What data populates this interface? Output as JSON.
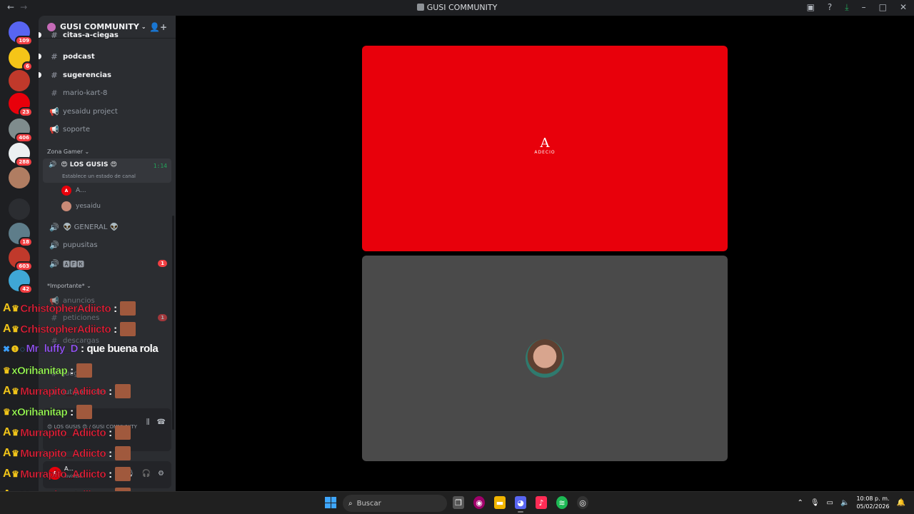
{
  "window": {
    "title": "GUSI COMMUNITY",
    "back": "←",
    "forward": "→"
  },
  "server_rail": [
    {
      "badge": "109",
      "color": "#5865f2"
    },
    {
      "badge": "6",
      "color": "#f5c518"
    },
    {
      "badge": "",
      "color": "#c0392b"
    },
    {
      "badge": "23",
      "color": "#e8000b"
    },
    {
      "badge": "406",
      "color": "#7f8c8d"
    },
    {
      "badge": "288",
      "color": "#ecf0f1"
    },
    {
      "badge": "",
      "color": "#b07d62"
    },
    {
      "badge": "",
      "color": "#2b2d31"
    },
    {
      "badge": "18",
      "color": "#5e7d8a"
    },
    {
      "badge": "603",
      "color": "#c0392b"
    },
    {
      "badge": "42",
      "color": "#3fa7d6"
    }
  ],
  "sidebar": {
    "server_name": "GUSI COMMUNITY",
    "channels_top": [
      {
        "name": "citas-a-ciegas",
        "icon": "hash-icon",
        "unread": true
      },
      {
        "name": "podcast",
        "icon": "hash-icon",
        "unread": true
      },
      {
        "name": "sugerencias",
        "icon": "hash-icon",
        "unread": true
      },
      {
        "name": "mario-kart-8",
        "icon": "hash-icon",
        "unread": false
      },
      {
        "name": "yesaidu project",
        "icon": "megaphone-icon",
        "unread": false
      },
      {
        "name": "soporte",
        "icon": "megaphone-icon",
        "unread": false
      }
    ],
    "category_zona": "Zona Gamer",
    "active_voice": {
      "name": "😍 LOS GUSIS 😍",
      "time": "1:14",
      "status": "Establece un estado de canal"
    },
    "voice_users": [
      {
        "name": "A...",
        "avatar": "A"
      },
      {
        "name": "yesaidu",
        "avatar": ""
      }
    ],
    "voice_channels": [
      {
        "name": "👽 GENERAL 👽",
        "mention": ""
      },
      {
        "name": "pupusitas",
        "mention": ""
      },
      {
        "name": "🅰🅵🅺",
        "mention": "1"
      }
    ],
    "category_importante": "*Importante*",
    "channels_bottom": [
      {
        "name": "anuncios",
        "icon": "megaphone-icon"
      },
      {
        "name": "peticiones",
        "icon": "hash-icon",
        "mention": "1"
      },
      {
        "name": "descargas",
        "icon": "hash-icon"
      },
      {
        "name": "juegitos",
        "icon": "hash-icon"
      },
      {
        "name": "lut-para-obs",
        "icon": "hash-icon"
      }
    ],
    "voice_panel_label": "😍 LOS GUSIS 😍 / GUSI COMMUNITY",
    "user_panel": {
      "name": "A...",
      "status": "Invisible",
      "avatar": "A"
    }
  },
  "stage": {
    "logo_letter": "A",
    "logo_text": "ADECIO"
  },
  "chat": [
    {
      "user": "CrhistopherAdiicto",
      "color": "#e0233b",
      "text": "",
      "emote": true,
      "badges": [
        "A",
        "crown"
      ]
    },
    {
      "user": "CrhistopherAdiicto",
      "color": "#e0233b",
      "text": "",
      "emote": true,
      "badges": [
        "A",
        "crown"
      ]
    },
    {
      "user": "Mr_luffy_D",
      "color": "#9b59ff",
      "text": "que buena rola",
      "emote": false,
      "badges": [
        "blue",
        "1",
        "ghost"
      ]
    },
    {
      "user": "xOrihanitap",
      "color": "#9cff57",
      "text": "",
      "emote": true,
      "badges": [
        "crown"
      ]
    },
    {
      "user": "Murrapito_Adiicto",
      "color": "#e0233b",
      "text": "",
      "emote": true,
      "badges": [
        "A",
        "crown"
      ]
    },
    {
      "user": "xOrihanitap",
      "color": "#9cff57",
      "text": "",
      "emote": true,
      "badges": [
        "crown"
      ]
    },
    {
      "user": "Murrapito_Adiicto",
      "color": "#e0233b",
      "text": "",
      "emote": true,
      "badges": [
        "A",
        "crown"
      ]
    },
    {
      "user": "Murrapito_Adiicto",
      "color": "#e0233b",
      "text": "",
      "emote": true,
      "badges": [
        "A",
        "crown"
      ]
    },
    {
      "user": "Murrapito_Adiicto",
      "color": "#e0233b",
      "text": "",
      "emote": true,
      "badges": [
        "A",
        "crown"
      ]
    },
    {
      "user": "Murrapito_Adiicto",
      "color": "#e0233b",
      "text": "",
      "emote": true,
      "badges": [
        "A",
        "crown"
      ]
    }
  ],
  "taskbar": {
    "search_placeholder": "Buscar",
    "time": "10:08 p. m.",
    "date": "05/02/2026"
  }
}
